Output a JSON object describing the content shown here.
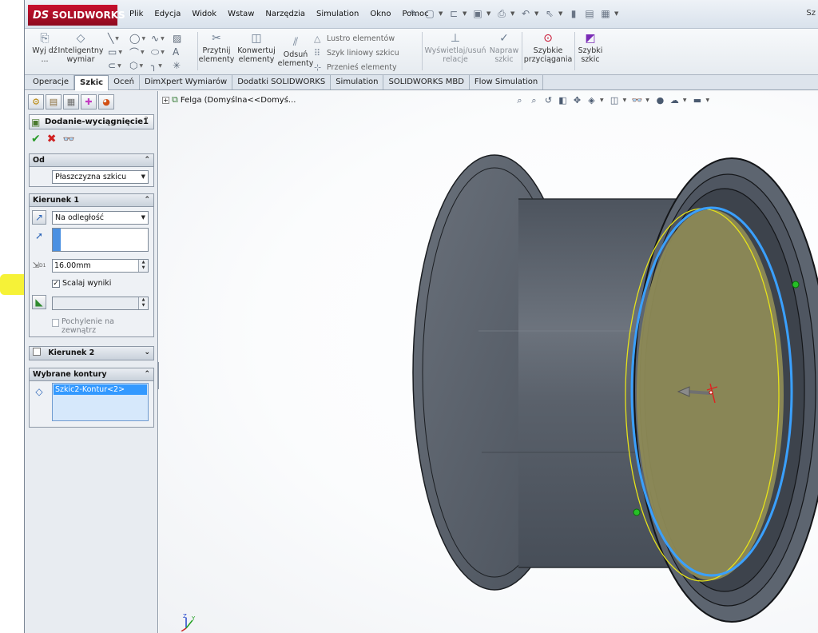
{
  "app": {
    "brand": "SOLIDWORKS",
    "brand_mark": "DS",
    "title_fragment": "Sz"
  },
  "menu": [
    "Plik",
    "Edycja",
    "Widok",
    "Wstaw",
    "Narzędzia",
    "Simulation",
    "Okno",
    "Pomoc"
  ],
  "ribbon": {
    "exit_sketch": "Wyj dź ...",
    "smart_dimension": "Inteligentny wymiar",
    "trim": "Przytnij elementy",
    "convert": "Konwertuj elementy",
    "offset": "Odsuń elementy",
    "mirror": "Lustro elementów",
    "linear_pattern": "Szyk liniowy szkicu",
    "move": "Przenieś elementy",
    "relations": "Wyświetlaj/usuń relacje",
    "repair": "Napraw szkic",
    "quick_snaps": "Szybkie przyciągania",
    "rapid_sketch": "Szybki szkic"
  },
  "tabs": [
    "Operacje",
    "Szkic",
    "Oceń",
    "DimXpert Wymiarów",
    "Dodatki SOLIDWORKS",
    "Simulation",
    "SOLIDWORKS MBD",
    "Flow Simulation"
  ],
  "active_tab": "Szkic",
  "panel": {
    "feature_title": "Dodanie-wyciągnięcie1",
    "help": "?",
    "from": {
      "header": "Od",
      "value": "Płaszczyzna szkicu"
    },
    "direction1": {
      "header": "Kierunek 1",
      "end_condition": "Na odległość",
      "depth": "16.00mm",
      "depth_icon_label": "D1",
      "merge_label": "Scalaj wyniki",
      "merge_checked": true,
      "draft_label": "Pochylenie na zewnątrz",
      "draft_checked": false
    },
    "direction2": {
      "header": "Kierunek 2",
      "checked": false
    },
    "contours": {
      "header": "Wybrane kontury",
      "items": [
        "Szkic2-Kontur<2>"
      ]
    }
  },
  "viewport": {
    "tree_label": "Felga  (Domyślna<<Domyś..."
  },
  "triad": {
    "z": "Z",
    "y": "Y"
  },
  "colors": {
    "brand_red": "#c8102e",
    "sketch_blue": "#3399ff",
    "highlight_yellow": "#f5f014",
    "part_gray": "#5d6570"
  }
}
